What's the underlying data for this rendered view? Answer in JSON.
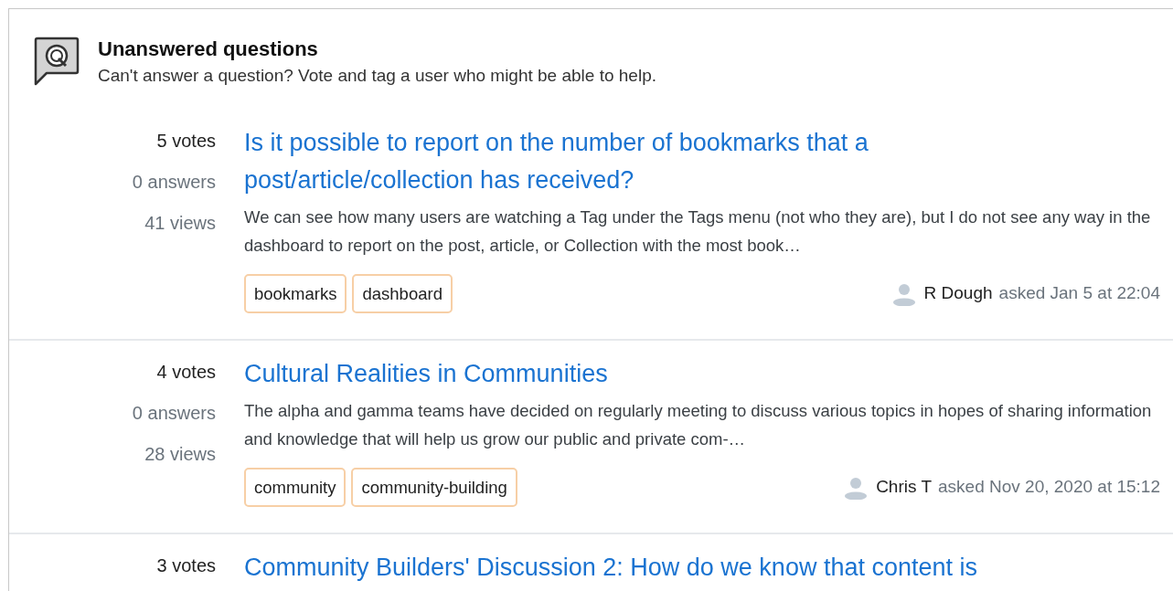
{
  "header": {
    "title": "Unanswered questions",
    "subtitle": "Can't answer a question? Vote and tag a user who might be able to help."
  },
  "questions": [
    {
      "votes": "5 votes",
      "answers": "0 answers",
      "views": "41 views",
      "title": "Is it possible to report on the number of bookmarks that a post/article/collection has received?",
      "excerpt": "We can see how many users are watching a Tag under the Tags menu (not who they are), but I do not see any way in the dashboard to report on the post, article, or Collection with the most book…",
      "tags": [
        "bookmarks",
        "dashboard"
      ],
      "author": "R Dough",
      "asked": "asked Jan 5 at 22:04"
    },
    {
      "votes": "4 votes",
      "answers": "0 answers",
      "views": "28 views",
      "title": "Cultural Realities in Communities",
      "excerpt": "The alpha and gamma teams have decided on regularly meeting to discuss various topics in hopes of sharing information and knowledge that will help us grow our public and private com-…",
      "tags": [
        "community",
        "community-building"
      ],
      "author": "Chris T",
      "asked": "asked Nov 20, 2020 at 15:12"
    },
    {
      "votes": "3 votes",
      "title": "Community Builders' Discussion 2: How do we know that content is"
    }
  ]
}
